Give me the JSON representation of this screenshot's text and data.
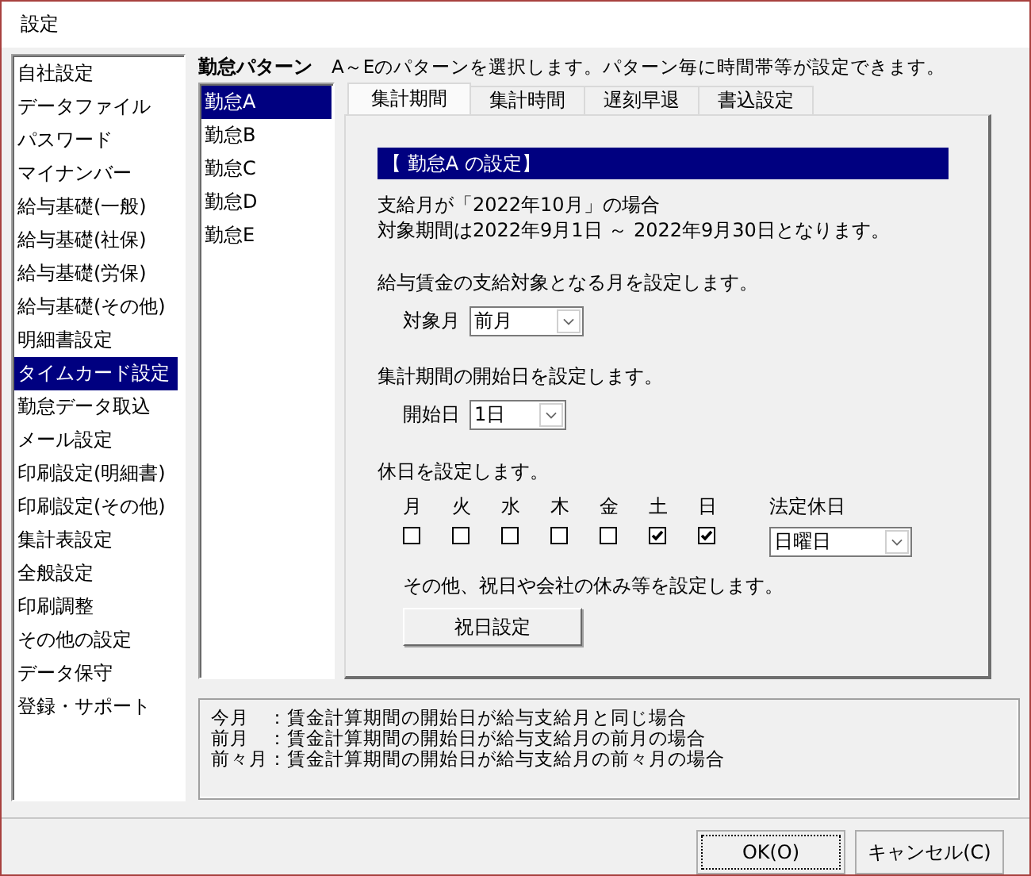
{
  "window": {
    "title": "設定"
  },
  "sidebar": {
    "items": [
      {
        "label": "自社設定",
        "selected": false
      },
      {
        "label": "データファイル",
        "selected": false
      },
      {
        "label": "パスワード",
        "selected": false
      },
      {
        "label": "マイナンバー",
        "selected": false
      },
      {
        "label": "給与基礎(一般)",
        "selected": false
      },
      {
        "label": "給与基礎(社保)",
        "selected": false
      },
      {
        "label": "給与基礎(労保)",
        "selected": false
      },
      {
        "label": "給与基礎(その他)",
        "selected": false
      },
      {
        "label": "明細書設定",
        "selected": false
      },
      {
        "label": "タイムカード設定",
        "selected": true
      },
      {
        "label": "勤怠データ取込",
        "selected": false
      },
      {
        "label": "メール設定",
        "selected": false
      },
      {
        "label": "印刷設定(明細書)",
        "selected": false
      },
      {
        "label": "印刷設定(その他)",
        "selected": false
      },
      {
        "label": "集計表設定",
        "selected": false
      },
      {
        "label": "全般設定",
        "selected": false
      },
      {
        "label": "印刷調整",
        "selected": false
      },
      {
        "label": "その他の設定",
        "selected": false
      },
      {
        "label": "データ保守",
        "selected": false
      },
      {
        "label": "登録・サポート",
        "selected": false
      }
    ]
  },
  "pattern": {
    "title": "勤怠パターン",
    "description": "A～Eのパターンを選択します。パターン毎に時間帯等が設定できます。",
    "items": [
      {
        "label": "勤怠A",
        "selected": true
      },
      {
        "label": "勤怠B",
        "selected": false
      },
      {
        "label": "勤怠C",
        "selected": false
      },
      {
        "label": "勤怠D",
        "selected": false
      },
      {
        "label": "勤怠E",
        "selected": false
      }
    ]
  },
  "tabs": [
    {
      "label": "集計期間",
      "selected": true
    },
    {
      "label": "集計時間",
      "selected": false
    },
    {
      "label": "遅刻早退",
      "selected": false
    },
    {
      "label": "書込設定",
      "selected": false
    }
  ],
  "panel": {
    "header": "【 勤怠A の設定】",
    "example_lines": [
      "支給月が「2022年10月」の場合",
      "対象期間は2022年9月1日 ～ 2022年9月30日となります。"
    ],
    "target_month": {
      "description": "給与賃金の支給対象となる月を設定します。",
      "label": "対象月",
      "value": "前月"
    },
    "start_day": {
      "description": "集計期間の開始日を設定します。",
      "label": "開始日",
      "value": "1日"
    },
    "holidays": {
      "description": "休日を設定します。",
      "days": [
        {
          "label": "月",
          "checked": false
        },
        {
          "label": "火",
          "checked": false
        },
        {
          "label": "水",
          "checked": false
        },
        {
          "label": "木",
          "checked": false
        },
        {
          "label": "金",
          "checked": false
        },
        {
          "label": "土",
          "checked": true
        },
        {
          "label": "日",
          "checked": true
        }
      ],
      "legal_holiday": {
        "label": "法定休日",
        "value": "日曜日"
      },
      "other_note": "その他、祝日や会社の休み等を設定します。",
      "button": "祝日設定"
    }
  },
  "notes": [
    "今月　：賃金計算期間の開始日が給与支給月と同じ場合",
    "前月　：賃金計算期間の開始日が給与支給月の前月の場合",
    "前々月：賃金計算期間の開始日が給与支給月の前々月の場合"
  ],
  "buttons": [
    {
      "label": "OK(O)",
      "focused": true
    },
    {
      "label": "キャンセル(C)",
      "focused": false
    }
  ]
}
